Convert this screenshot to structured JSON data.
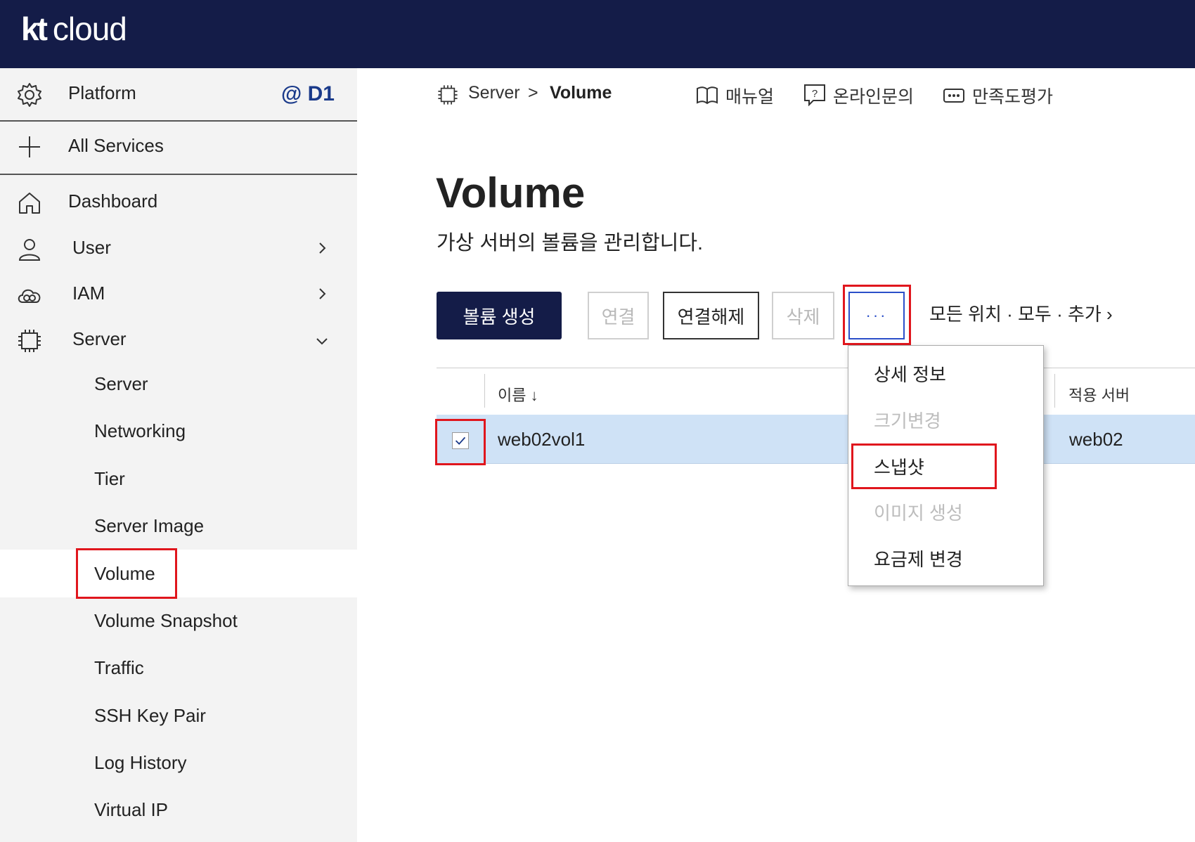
{
  "header": {
    "logo_kt": "kt",
    "logo_cloud": "cloud"
  },
  "sidebar": {
    "platform_label": "Platform",
    "zone": "@ D1",
    "all_services": "All Services",
    "items": [
      {
        "label": "Dashboard",
        "icon": "home-icon"
      },
      {
        "label": "User",
        "icon": "user-icon"
      },
      {
        "label": "IAM",
        "icon": "cloud-icon"
      },
      {
        "label": "Server",
        "icon": "chip-icon"
      }
    ],
    "server_sub": [
      "Server",
      "Networking",
      "Tier",
      "Server Image",
      "Volume",
      "Volume Snapshot",
      "Traffic",
      "SSH Key Pair",
      "Log History",
      "Virtual IP"
    ],
    "active": "Volume"
  },
  "breadcrumb": {
    "parent": "Server",
    "separator": ">",
    "current": "Volume"
  },
  "top_links": {
    "manual": "매뉴얼",
    "inquiry": "온라인문의",
    "survey": "만족도평가"
  },
  "page": {
    "title": "Volume",
    "subtitle": "가상 서버의 볼륨을 관리합니다."
  },
  "toolbar": {
    "create": "볼륨 생성",
    "attach": "연결",
    "detach": "연결해제",
    "delete": "삭제",
    "more": "···",
    "filter": "모든 위치 · 모두 · 추가 ›"
  },
  "table": {
    "columns": {
      "name": "이름 ↓",
      "server": "적용 서버"
    },
    "rows": [
      {
        "name": "web02vol1",
        "server": "web02",
        "checked": true
      }
    ]
  },
  "menu": {
    "items": [
      {
        "label": "상세 정보",
        "disabled": false
      },
      {
        "label": "크기변경",
        "disabled": true
      },
      {
        "label": "스냅샷",
        "disabled": false
      },
      {
        "label": "이미지 생성",
        "disabled": true
      },
      {
        "label": "요금제 변경",
        "disabled": false
      }
    ]
  },
  "colors": {
    "nav": "#141c48",
    "highlight": "#e0161d",
    "selected_row": "#cfe2f6",
    "accent": "#1a3a8a"
  }
}
